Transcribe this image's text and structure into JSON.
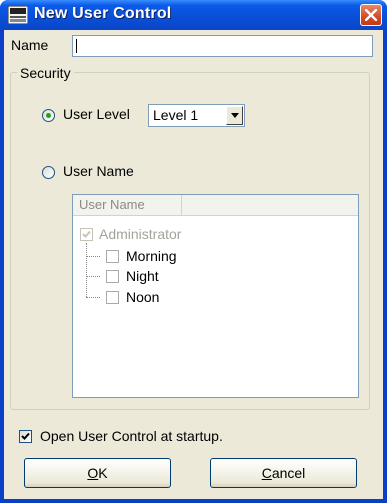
{
  "window": {
    "title": "New User Control",
    "app_icon": "app-logo-icon",
    "close_icon": "close-icon"
  },
  "name_field": {
    "label": "Name",
    "value": ""
  },
  "security": {
    "group_title": "Security",
    "user_level_option": {
      "label": "User Level",
      "selected": true
    },
    "user_level_select": {
      "value": "Level 1",
      "arrow_icon": "chevron-down-icon"
    },
    "user_name_option": {
      "label": "User Name",
      "selected": false
    },
    "user_list": {
      "column_header": "User Name",
      "root": {
        "label": "Administrator",
        "checked": true,
        "disabled": true
      },
      "children": [
        {
          "label": "Morning",
          "checked": false
        },
        {
          "label": "Night",
          "checked": false
        },
        {
          "label": "Noon",
          "checked": false
        }
      ]
    }
  },
  "startup_option": {
    "label": "Open User Control at startup.",
    "checked": true
  },
  "buttons": {
    "ok_mnemonic": "O",
    "ok_rest": "K",
    "cancel_mnemonic": "C",
    "cancel_rest": "ancel"
  }
}
